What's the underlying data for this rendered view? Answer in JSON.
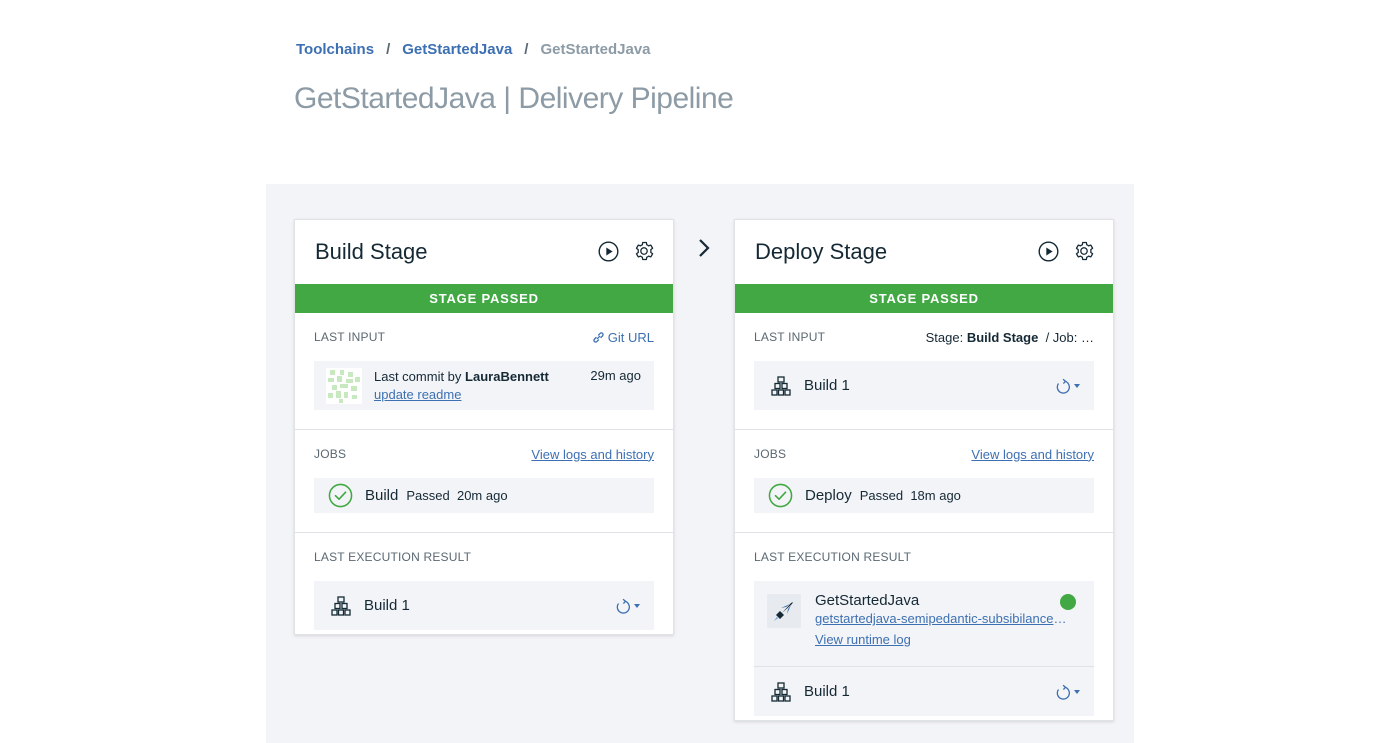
{
  "breadcrumb": {
    "items": [
      "Toolchains",
      "GetStartedJava"
    ],
    "current": "GetStartedJava",
    "separator": "/"
  },
  "page_title": "GetStartedJava | Delivery Pipeline",
  "colors": {
    "passed": "#41a843",
    "link": "#3d70b2",
    "background": "#f3f4f7"
  },
  "stages": [
    {
      "title": "Build Stage",
      "status": "STAGE PASSED",
      "last_input": {
        "label": "LAST INPUT",
        "link": "Git URL",
        "commit_prefix": "Last commit by",
        "author": "LauraBennett",
        "message": "update readme",
        "time": "29m ago"
      },
      "jobs": {
        "label": "JOBS",
        "link": "View logs and history",
        "items": [
          {
            "name": "Build",
            "status": "Passed",
            "time": "20m ago"
          }
        ]
      },
      "last_execution": {
        "label": "LAST EXECUTION RESULT",
        "build": "Build 1"
      }
    },
    {
      "title": "Deploy Stage",
      "status": "STAGE PASSED",
      "last_input": {
        "label": "LAST INPUT",
        "stage_prefix": "Stage:",
        "stage_name": "Build Stage",
        "job_part": "/  Job: …",
        "build": "Build 1"
      },
      "jobs": {
        "label": "JOBS",
        "link": "View logs and history",
        "items": [
          {
            "name": "Deploy",
            "status": "Passed",
            "time": "18m ago"
          }
        ]
      },
      "last_execution": {
        "label": "LAST EXECUTION RESULT",
        "app_name": "GetStartedJava",
        "app_url": "getstartedjava-semipedantic-subsibilance.mybluemix.net",
        "runtime_link": "View runtime log",
        "build": "Build 1"
      }
    }
  ]
}
